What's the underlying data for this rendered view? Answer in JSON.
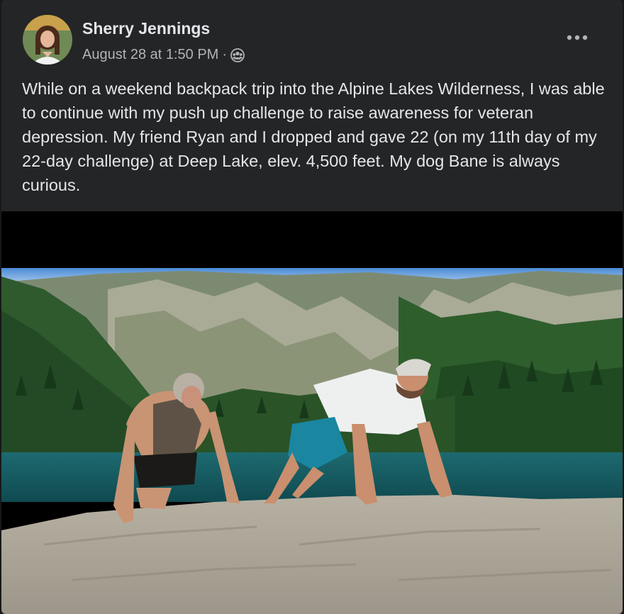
{
  "post": {
    "author": "Sherry Jennings",
    "timestamp": "August 28 at 1:50 PM",
    "separator": "·",
    "audience_icon": "friends-icon",
    "more_icon": "more-options-icon",
    "caption": "While on a weekend backpack trip into the Alpine Lakes Wilderness, I was able to continue with my push up challenge to raise awareness for veteran depression. My friend Ryan and I dropped and gave 22 (on my 11th day of my 22-day challenge) at Deep Lake, elev. 4,500 feet. My dog Bane is always curious."
  },
  "colors": {
    "page_bg": "#18191a",
    "card_bg": "#242526",
    "primary_text": "#e4e6eb",
    "secondary_text": "#b0b3b8",
    "video_letterbox": "#000000"
  }
}
